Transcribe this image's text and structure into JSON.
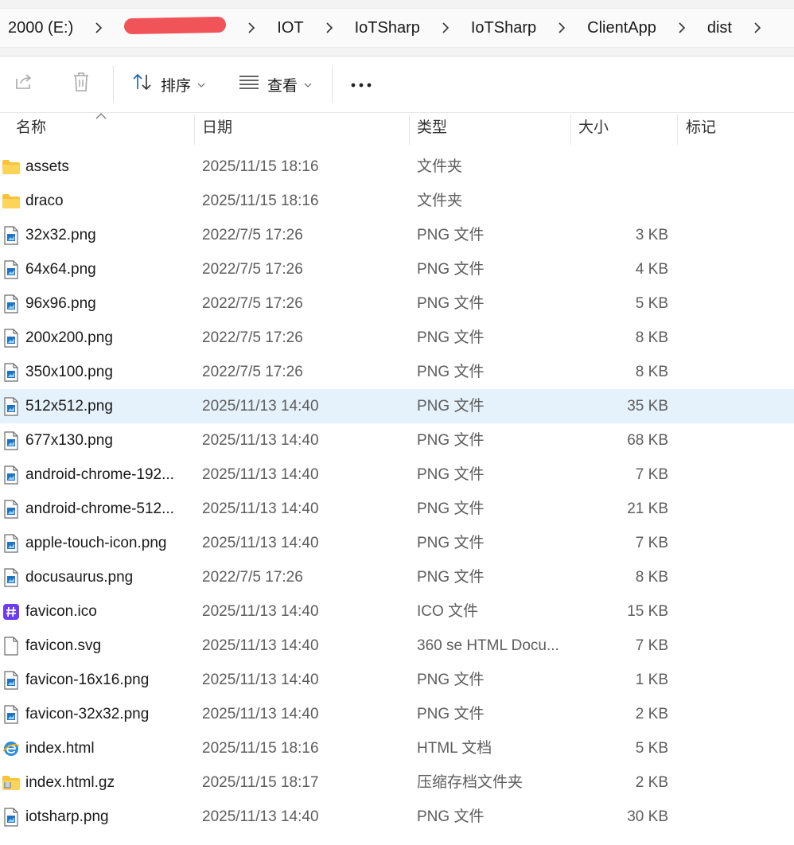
{
  "breadcrumb": {
    "items": [
      "2000 (E:)",
      "",
      "IOT",
      "IoTSharp",
      "IoTSharp",
      "ClientApp",
      "dist"
    ]
  },
  "toolbar": {
    "sort_label": "排序",
    "view_label": "查看"
  },
  "columns": {
    "name": "名称",
    "date": "日期",
    "type": "类型",
    "size": "大小",
    "tags": "标记"
  },
  "files": [
    {
      "name": "assets",
      "date": "2025/11/15 18:16",
      "type": "文件夹",
      "size": "",
      "icon": "folder-icon"
    },
    {
      "name": "draco",
      "date": "2025/11/15 18:16",
      "type": "文件夹",
      "size": "",
      "icon": "folder-icon"
    },
    {
      "name": "32x32.png",
      "date": "2022/7/5 17:26",
      "type": "PNG 文件",
      "size": "3 KB",
      "icon": "png-file-icon"
    },
    {
      "name": "64x64.png",
      "date": "2022/7/5 17:26",
      "type": "PNG 文件",
      "size": "4 KB",
      "icon": "png-file-icon"
    },
    {
      "name": "96x96.png",
      "date": "2022/7/5 17:26",
      "type": "PNG 文件",
      "size": "5 KB",
      "icon": "png-file-icon"
    },
    {
      "name": "200x200.png",
      "date": "2022/7/5 17:26",
      "type": "PNG 文件",
      "size": "8 KB",
      "icon": "png-file-icon"
    },
    {
      "name": "350x100.png",
      "date": "2022/7/5 17:26",
      "type": "PNG 文件",
      "size": "8 KB",
      "icon": "png-file-icon"
    },
    {
      "name": "512x512.png",
      "date": "2025/11/13 14:40",
      "type": "PNG 文件",
      "size": "35 KB",
      "icon": "png-file-icon",
      "selected": true
    },
    {
      "name": "677x130.png",
      "date": "2025/11/13 14:40",
      "type": "PNG 文件",
      "size": "68 KB",
      "icon": "png-file-icon"
    },
    {
      "name": "android-chrome-192...",
      "date": "2025/11/13 14:40",
      "type": "PNG 文件",
      "size": "7 KB",
      "icon": "png-file-icon"
    },
    {
      "name": "android-chrome-512...",
      "date": "2025/11/13 14:40",
      "type": "PNG 文件",
      "size": "21 KB",
      "icon": "png-file-icon"
    },
    {
      "name": "apple-touch-icon.png",
      "date": "2025/11/13 14:40",
      "type": "PNG 文件",
      "size": "7 KB",
      "icon": "png-file-icon"
    },
    {
      "name": "docusaurus.png",
      "date": "2022/7/5 17:26",
      "type": "PNG 文件",
      "size": "8 KB",
      "icon": "png-file-icon"
    },
    {
      "name": "favicon.ico",
      "date": "2025/11/13 14:40",
      "type": "ICO 文件",
      "size": "15 KB",
      "icon": "ico-file-icon"
    },
    {
      "name": "favicon.svg",
      "date": "2025/11/13 14:40",
      "type": "360 se HTML Docu...",
      "size": "7 KB",
      "icon": "blank-file-icon"
    },
    {
      "name": "favicon-16x16.png",
      "date": "2025/11/13 14:40",
      "type": "PNG 文件",
      "size": "1 KB",
      "icon": "png-file-icon"
    },
    {
      "name": "favicon-32x32.png",
      "date": "2025/11/13 14:40",
      "type": "PNG 文件",
      "size": "2 KB",
      "icon": "png-file-icon"
    },
    {
      "name": "index.html",
      "date": "2025/11/15 18:16",
      "type": "HTML 文档",
      "size": "5 KB",
      "icon": "html-file-icon"
    },
    {
      "name": "index.html.gz",
      "date": "2025/11/15 18:17",
      "type": "压缩存档文件夹",
      "size": "2 KB",
      "icon": "zip-folder-icon"
    },
    {
      "name": "iotsharp.png",
      "date": "2025/11/13 14:40",
      "type": "PNG 文件",
      "size": "30 KB",
      "icon": "png-file-icon"
    }
  ],
  "colors": {
    "selection": "#e5f1fb",
    "accent": "#0067c0",
    "folder": "#f8c33b",
    "ico": "#6b3df0"
  }
}
